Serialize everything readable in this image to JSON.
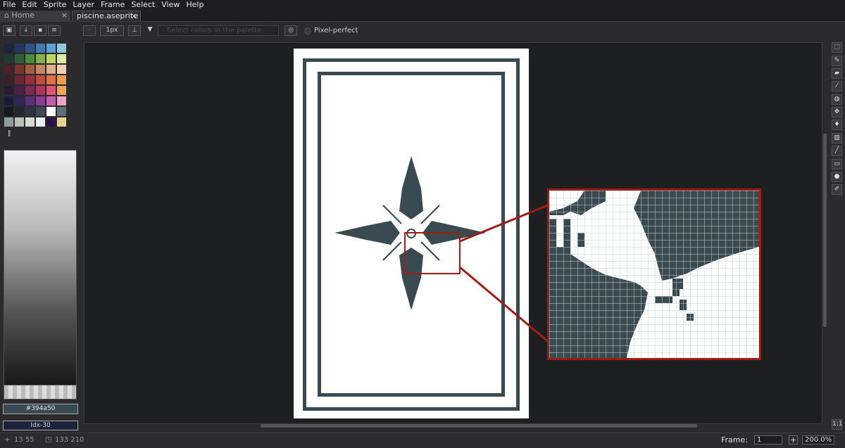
{
  "menu": {
    "items": [
      "File",
      "Edit",
      "Sprite",
      "Layer",
      "Frame",
      "Select",
      "View",
      "Help"
    ]
  },
  "tabs": {
    "home": "Home",
    "file": "piscine.aseprite",
    "close": "×"
  },
  "toolbar": {
    "brush_size": "1px",
    "filter_placeholder": "Select colors in the palette",
    "pixel_perfect_label": "Pixel-perfect"
  },
  "palette": {
    "colors": [
      "#1b2441",
      "#253663",
      "#2d5587",
      "#3f7ab3",
      "#5ea0cf",
      "#8dc9d9",
      "#1e3a2e",
      "#2c5e3a",
      "#4b8b3d",
      "#82b34a",
      "#bfd663",
      "#dfe9a3",
      "#4a2128",
      "#7a3533",
      "#a35a3f",
      "#c6865d",
      "#dcae8b",
      "#efd2b5",
      "#3a1f2c",
      "#6a2634",
      "#99303b",
      "#c44a3a",
      "#e07043",
      "#ee9c4b",
      "#2a1a36",
      "#4a2148",
      "#7d2a5a",
      "#b3335f",
      "#dd5470",
      "#f0a457",
      "#1b1a3a",
      "#2d2457",
      "#5a2f78",
      "#8c3c93",
      "#c35eaa",
      "#e8a6c4",
      "#15181d",
      "#222631",
      "#2e3441",
      "#3f4855",
      "#ffffff",
      "#5e7074",
      "#8f9c99",
      "#b8c2bb",
      "#d6dbd1",
      "#ebeef0",
      "#2a1540",
      "#e8d48f"
    ]
  },
  "color": {
    "hex": "#394a50",
    "index": "Idx-30",
    "fg": "#394a50"
  },
  "status": {
    "cursor": "13 55",
    "size": "133 210",
    "frame_label": "Frame:",
    "frame_value": "1",
    "plus": "+",
    "zoom": "200.0%"
  },
  "tools": [
    "marquee-icon",
    "pencil-icon",
    "eraser-icon",
    "eyedropper-icon",
    "zoom-icon",
    "move-icon",
    "fill-icon",
    "gradient-icon",
    "line-icon",
    "rectangle-icon",
    "blur-icon",
    "smudge-icon"
  ]
}
